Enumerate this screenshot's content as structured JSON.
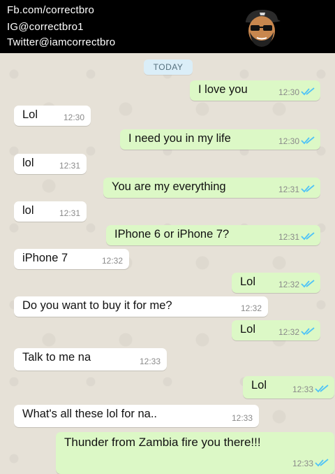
{
  "header": {
    "line1": "Fb.com/correctbro",
    "line2": "IG@correctbro1",
    "line3": "Twitter@iamcorrectbro"
  },
  "chat": {
    "date_label": "TODAY",
    "messages": [
      {
        "dir": "out",
        "text": "I love you",
        "time": "12:30"
      },
      {
        "dir": "in",
        "text": "Lol",
        "time": "12:30"
      },
      {
        "dir": "out",
        "text": "I need you in my life",
        "time": "12:30"
      },
      {
        "dir": "in",
        "text": "lol",
        "time": "12:31"
      },
      {
        "dir": "out",
        "text": "You are my everything",
        "time": "12:31"
      },
      {
        "dir": "in",
        "text": "lol",
        "time": "12:31"
      },
      {
        "dir": "out",
        "text": "IPhone 6 or iPhone 7?",
        "time": "12:31"
      },
      {
        "dir": "in",
        "text": "iPhone 7",
        "time": "12:32"
      },
      {
        "dir": "out",
        "text": "Lol",
        "time": "12:32"
      },
      {
        "dir": "in",
        "text": "Do you want to buy it for me?",
        "time": "12:32"
      },
      {
        "dir": "out",
        "text": "Lol",
        "time": "12:32"
      },
      {
        "dir": "in",
        "text": "Talk to me na",
        "time": "12:33"
      },
      {
        "dir": "out",
        "text": "Lol",
        "time": "12:33"
      },
      {
        "dir": "in",
        "text": "What's all these lol for na..",
        "time": "12:33"
      },
      {
        "dir": "out",
        "text": "Thunder from Zambia fire you there!!!",
        "time": "12:33"
      }
    ]
  },
  "colors": {
    "incoming_bubble": "#ffffff",
    "outgoing_bubble": "#dcf8c6",
    "read_ticks": "#4fc3f7",
    "header_bg": "#000000"
  },
  "icons": [
    "avatar-cartoon",
    "double-check-icon"
  ]
}
